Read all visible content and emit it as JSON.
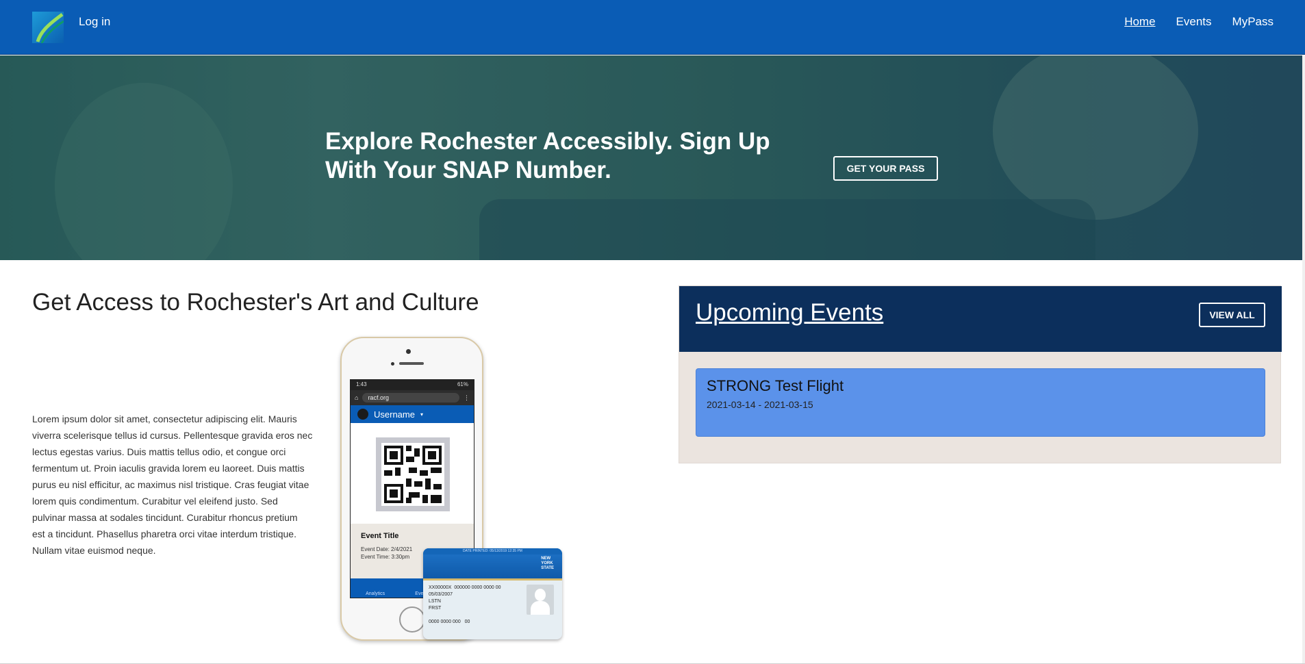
{
  "navbar": {
    "login_label": "Log in",
    "links": [
      {
        "label": "Home",
        "active": true
      },
      {
        "label": "Events",
        "active": false
      },
      {
        "label": "MyPass",
        "active": false
      }
    ],
    "brand_color": "#0a5cb5"
  },
  "hero": {
    "title": "Explore Rochester Accessibly. Sign Up With Your SNAP Number.",
    "button_label": "GET YOUR PASS"
  },
  "main": {
    "section_title": "Get Access to Rochester's Art and Culture",
    "body_text": "Lorem ipsum dolor sit amet, consectetur adipiscing elit. Mauris viverra scelerisque tellus id cursus. Pellentesque gravida eros nec lectus egestas varius. Duis mattis tellus odio, et congue orci fermentum ut. Proin iaculis gravida lorem eu laoreet. Duis mattis purus eu nisl efficitur, ac maximus nisl tristique. Cras feugiat vitae lorem quis condimentum. Curabitur vel eleifend justo. Sed pulvinar massa at sodales tincidunt. Curabitur rhoncus pretium est a tincidunt. Phasellus pharetra orci vitae interdum tristique. Nullam vitae euismod neque.",
    "phone": {
      "status_time": "1:43",
      "status_battery": "61%",
      "url": "racf.org",
      "username": "Username",
      "event_title": "Event Title",
      "event_date": "Event Date: 2/4/2021",
      "event_time": "Event Time: 3:30pm",
      "tabs": [
        "Analytics",
        "Events"
      ]
    },
    "id_card": {
      "header_strip": "DATE PRINTED: 05/13/2019 12:35 PM",
      "state_lines": [
        "NEW",
        "YORK",
        "STATE"
      ],
      "id_number": "XX00000X",
      "card_number": "000000 0000 0000 00",
      "dob": "05/03/2007",
      "last_name": "LSTN",
      "first_name": "FRST",
      "access_number": "0000 0000 000",
      "access_suffix": "00"
    }
  },
  "events": {
    "title": "Upcoming Events",
    "view_all_label": "VIEW ALL",
    "items": [
      {
        "name": "STRONG Test Flight",
        "dates": "2021-03-14 - 2021-03-15"
      }
    ],
    "header_color": "#0c2f5c",
    "item_color": "#5b92ea"
  }
}
